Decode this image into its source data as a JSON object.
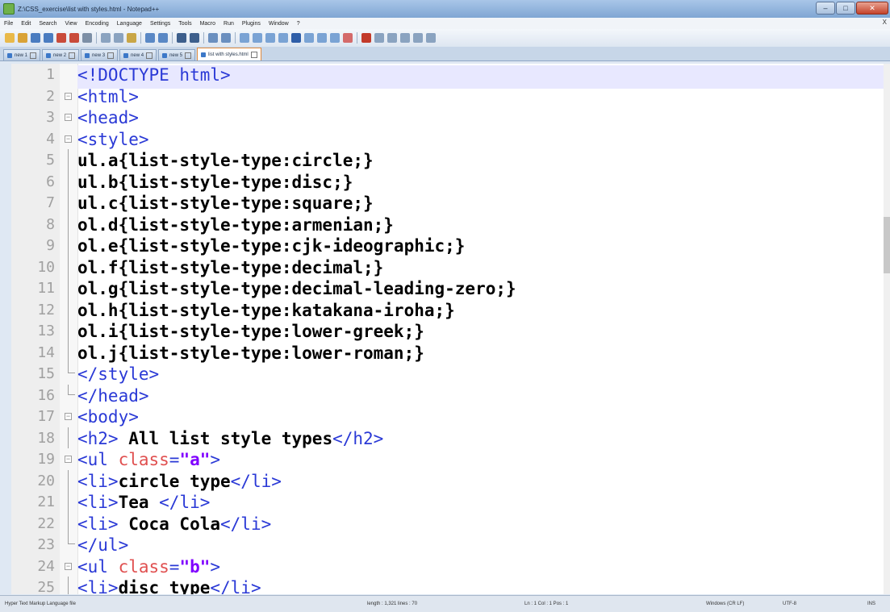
{
  "window": {
    "title": "Z:\\CSS_exercise\\list with styles.html - Notepad++",
    "controls": [
      "–",
      "□",
      "✕"
    ]
  },
  "menu": [
    "File",
    "Edit",
    "Search",
    "View",
    "Encoding",
    "Language",
    "Settings",
    "Tools",
    "Macro",
    "Run",
    "Plugins",
    "Window",
    "?"
  ],
  "menu_close": "X",
  "tabs": [
    {
      "label": "new 1"
    },
    {
      "label": "new 2"
    },
    {
      "label": "new 3"
    },
    {
      "label": "new 4"
    },
    {
      "label": "new 5"
    },
    {
      "label": "list with styles.html",
      "active": true
    }
  ],
  "editor": {
    "lines": [
      {
        "n": "1",
        "fold": "",
        "parts": [
          [
            "doctype",
            "<!DOCTYPE html>"
          ]
        ]
      },
      {
        "n": "2",
        "fold": "box",
        "parts": [
          [
            "tag",
            "<html>"
          ]
        ]
      },
      {
        "n": "3",
        "fold": "box",
        "parts": [
          [
            "tag",
            "<head>"
          ]
        ]
      },
      {
        "n": "4",
        "fold": "box",
        "parts": [
          [
            "tag",
            "<style>"
          ]
        ]
      },
      {
        "n": "5",
        "fold": "line",
        "parts": [
          [
            "txt",
            "ul.a{list-style-type:circle;}"
          ]
        ]
      },
      {
        "n": "6",
        "fold": "line",
        "parts": [
          [
            "txt",
            "ul.b{list-style-type:disc;}"
          ]
        ]
      },
      {
        "n": "7",
        "fold": "line",
        "parts": [
          [
            "txt",
            "ul.c{list-style-type:square;}"
          ]
        ]
      },
      {
        "n": "8",
        "fold": "line",
        "parts": [
          [
            "txt",
            "ol.d{list-style-type:armenian;}"
          ]
        ]
      },
      {
        "n": "9",
        "fold": "line",
        "parts": [
          [
            "txt",
            "ol.e{list-style-type:cjk-ideographic;}"
          ]
        ]
      },
      {
        "n": "10",
        "fold": "line",
        "parts": [
          [
            "txt",
            "ol.f{list-style-type:decimal;}"
          ]
        ]
      },
      {
        "n": "11",
        "fold": "line",
        "parts": [
          [
            "txt",
            "ol.g{list-style-type:decimal-leading-zero;}"
          ]
        ]
      },
      {
        "n": "12",
        "fold": "line",
        "parts": [
          [
            "txt",
            "ol.h{list-style-type:katakana-iroha;}"
          ]
        ]
      },
      {
        "n": "13",
        "fold": "line",
        "parts": [
          [
            "txt",
            "ol.i{list-style-type:lower-greek;}"
          ]
        ]
      },
      {
        "n": "14",
        "fold": "line",
        "parts": [
          [
            "txt",
            "ol.j{list-style-type:lower-roman;}"
          ]
        ]
      },
      {
        "n": "15",
        "fold": "end",
        "parts": [
          [
            "tag",
            "</style>"
          ]
        ]
      },
      {
        "n": "16",
        "fold": "end",
        "parts": [
          [
            "tag",
            "</head>"
          ]
        ]
      },
      {
        "n": "17",
        "fold": "box",
        "parts": [
          [
            "tag",
            "<body>"
          ]
        ]
      },
      {
        "n": "18",
        "fold": "line",
        "parts": [
          [
            "tag",
            "<h2>"
          ],
          [
            "txt",
            " All list style types"
          ],
          [
            "tag",
            "</h2>"
          ]
        ]
      },
      {
        "n": "19",
        "fold": "box",
        "parts": [
          [
            "tag",
            "<ul "
          ],
          [
            "attr",
            "class"
          ],
          [
            "tag",
            "="
          ],
          [
            "str",
            "\"a\""
          ],
          [
            "tag",
            ">"
          ]
        ]
      },
      {
        "n": "20",
        "fold": "line",
        "parts": [
          [
            "tag",
            "<li>"
          ],
          [
            "txt",
            "circle type"
          ],
          [
            "tag",
            "</li>"
          ]
        ]
      },
      {
        "n": "21",
        "fold": "line",
        "parts": [
          [
            "tag",
            "<li>"
          ],
          [
            "txt",
            "Tea "
          ],
          [
            "tag",
            "</li>"
          ]
        ]
      },
      {
        "n": "22",
        "fold": "line",
        "parts": [
          [
            "tag",
            "<li>"
          ],
          [
            "txt",
            " Coca Cola"
          ],
          [
            "tag",
            "</li>"
          ]
        ]
      },
      {
        "n": "23",
        "fold": "end",
        "parts": [
          [
            "tag",
            "</ul>"
          ]
        ]
      },
      {
        "n": "24",
        "fold": "box",
        "parts": [
          [
            "tag",
            "<ul "
          ],
          [
            "attr",
            "class"
          ],
          [
            "tag",
            "="
          ],
          [
            "str",
            "\"b\""
          ],
          [
            "tag",
            ">"
          ]
        ]
      },
      {
        "n": "25",
        "fold": "line",
        "parts": [
          [
            "tag",
            "<li>"
          ],
          [
            "txt",
            "disc type"
          ],
          [
            "tag",
            "</li>"
          ]
        ]
      }
    ]
  },
  "status": {
    "file_type": "Hyper Text Markup Language file",
    "length": "length : 1,321    lines : 70",
    "position": "Ln : 1    Col : 1    Pos : 1",
    "eol": "Windows (CR LF)",
    "encoding": "UTF-8",
    "mode": "INS"
  },
  "colors": {
    "tag": "#2a39d6",
    "text": "#000000",
    "attribute": "#e05050",
    "string": "#8000ff",
    "current_line": "#e8e8ff"
  }
}
